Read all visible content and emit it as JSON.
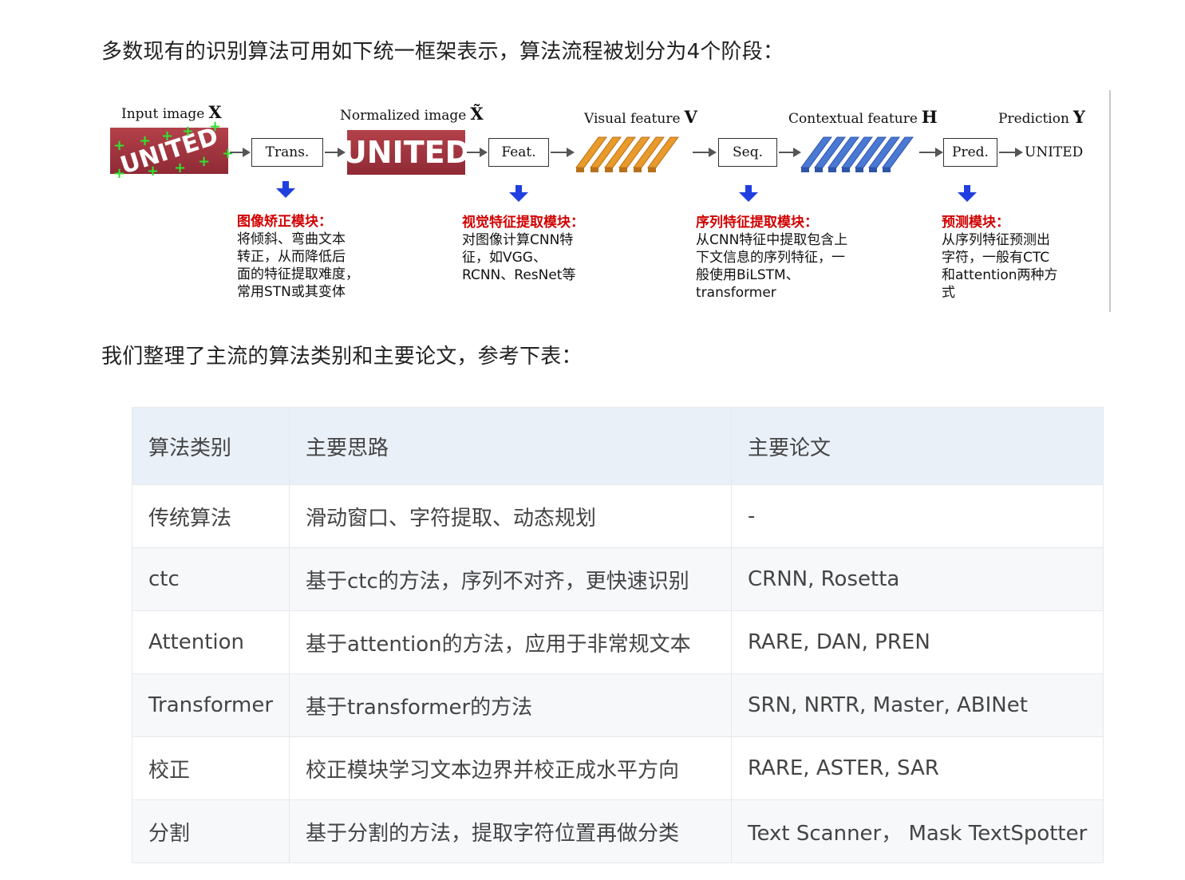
{
  "intro_text": "多数现有的识别算法可用如下统一框架表示，算法流程被划分为4个阶段：",
  "diagram": {
    "input_label": "Input image",
    "input_symbol": "X",
    "normalized_label": "Normalized image",
    "normalized_symbol": "X̃",
    "visual_label": "Visual feature",
    "visual_symbol": "V",
    "contextual_label": "Contextual feature",
    "contextual_symbol": "H",
    "prediction_label": "Prediction",
    "prediction_symbol": "Y",
    "input_image_text": "UNITED",
    "normalized_image_text": "UNITED",
    "boxes": {
      "trans": "Trans.",
      "feat": "Feat.",
      "seq": "Seq.",
      "pred": "Pred."
    },
    "output_text": "UNITED",
    "colors": {
      "visual_feature": "#e89a2a",
      "contextual_feature": "#4a79d4",
      "down_arrow": "#1f3fe0",
      "module_title": "#d10000"
    },
    "modules": [
      {
        "title": "图像矫正模块：",
        "lines": [
          "将倾斜、弯曲文本",
          "转正，从而降低后",
          "面的特征提取难度，",
          "常用STN或其变体"
        ]
      },
      {
        "title": "视觉特征提取模块：",
        "lines": [
          "对图像计算CNN特",
          "征，如VGG、",
          "RCNN、ResNet等"
        ]
      },
      {
        "title": "序列特征提取模块：",
        "lines": [
          "从CNN特征中提取包含上",
          "下文信息的序列特征，一",
          "般使用BiLSTM、",
          "transformer"
        ]
      },
      {
        "title": "预测模块：",
        "lines": [
          "从序列特征预测出",
          "字符，一般有CTC",
          "和attention两种方",
          "式"
        ]
      }
    ]
  },
  "table_intro": "我们整理了主流的算法类别和主要论文，参考下表：",
  "table": {
    "headers": [
      "算法类别",
      "主要思路",
      "主要论文"
    ],
    "rows": [
      [
        "传统算法",
        "滑动窗口、字符提取、动态规划",
        "-"
      ],
      [
        "ctc",
        "基于ctc的方法，序列不对齐，更快速识别",
        "CRNN, Rosetta"
      ],
      [
        "Attention",
        "基于attention的方法，应用于非常规文本",
        "RARE, DAN, PREN"
      ],
      [
        "Transformer",
        "基于transformer的方法",
        "SRN, NRTR, Master, ABINet"
      ],
      [
        "校正",
        "校正模块学习文本边界并校正成水平方向",
        "RARE, ASTER, SAR"
      ],
      [
        "分割",
        "基于分割的方法，提取字符位置再做分类",
        "Text Scanner， Mask TextSpotter"
      ]
    ]
  }
}
